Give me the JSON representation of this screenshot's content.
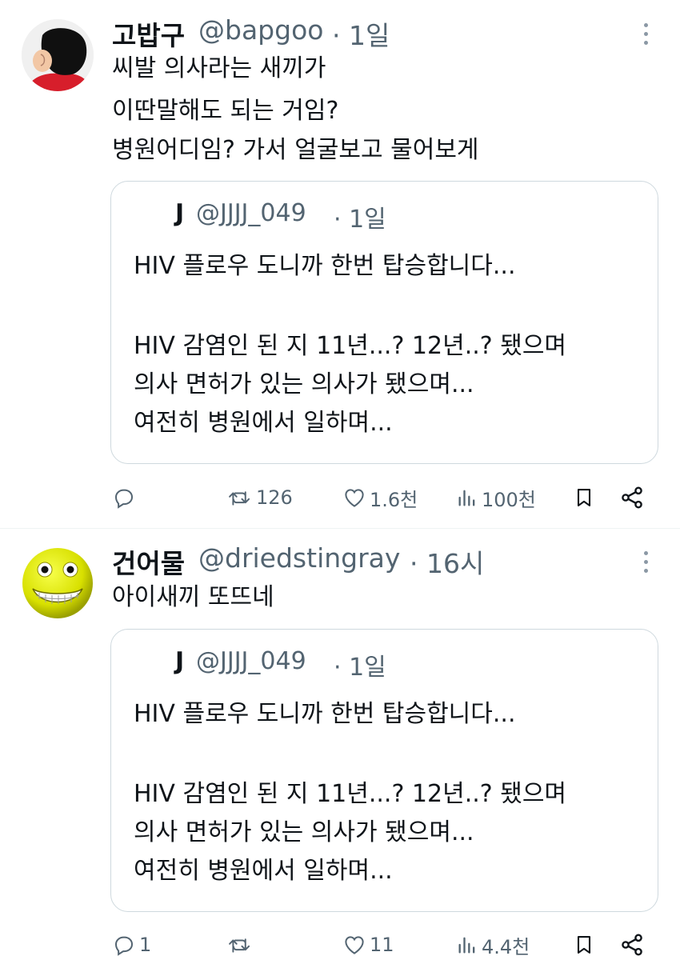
{
  "tweets": [
    {
      "author_name": "고밥구",
      "author_handle": "@bapgoo",
      "time": "· 1일",
      "body": [
        "씨발 의사라는 새끼가",
        "이딴말해도 되는 거임?",
        "병원어디임? 가서 얼굴보고 물어보게"
      ],
      "quote": {
        "author_name": "J",
        "author_handle": "@JJJJ_049",
        "time": "· 1일",
        "lines": [
          "HIV 플로우 도니까 한번 탑승합니다...",
          "",
          "HIV 감염인 된 지 11년...? 12년..? 됐으며",
          "의사 면허가 있는 의사가 됐으며...",
          "여전히 병원에서 일하며..."
        ]
      },
      "actions": {
        "replies": "",
        "retweets": "126",
        "likes": "1.6천",
        "views": "100천"
      },
      "avatar_icon": "cartoon-man-avatar-icon"
    },
    {
      "author_name": "건어물",
      "author_handle": "@driedstingray",
      "time": "· 16시",
      "body": [
        "아이새끼 또뜨네"
      ],
      "quote": {
        "author_name": "J",
        "author_handle": "@JJJJ_049",
        "time": "· 1일",
        "lines": [
          "HIV 플로우 도니까 한번 탑승합니다...",
          "",
          "HIV 감염인 된 지 11년...? 12년..? 됐으며",
          "의사 면허가 있는 의사가 됐으며...",
          "여전히 병원에서 일하며..."
        ]
      },
      "actions": {
        "replies": "1",
        "retweets": "",
        "likes": "11",
        "views": "4.4천"
      },
      "avatar_icon": "yellow-grin-face-avatar-icon"
    }
  ],
  "colors": {
    "text": "#0f1419",
    "secondary": "#536471",
    "border": "#cfd9de"
  },
  "icons": [
    "reply-icon",
    "retweet-icon",
    "like-icon",
    "views-icon",
    "bookmark-icon",
    "share-icon",
    "more-options-icon"
  ]
}
